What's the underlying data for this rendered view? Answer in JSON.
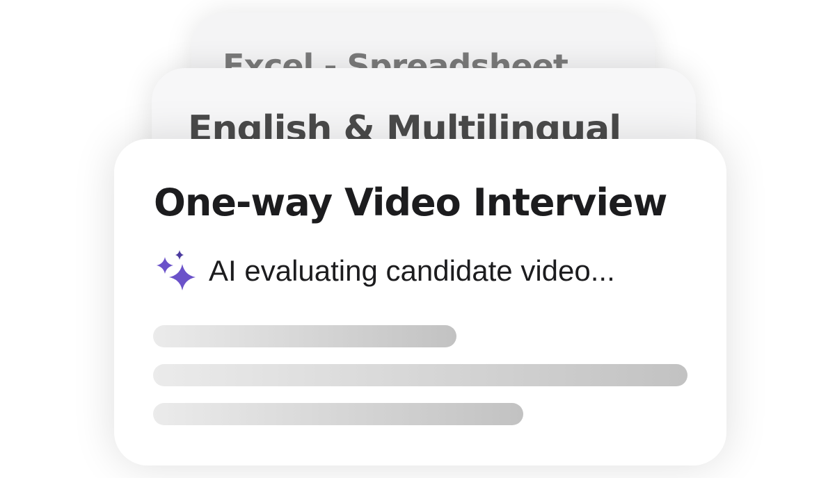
{
  "cards": {
    "back": {
      "title": "Excel - Spreadsheet"
    },
    "middle": {
      "title": "English & Multilingual"
    },
    "front": {
      "title": "One-way Video Interview",
      "status": {
        "icon": "sparkle-icon",
        "text": "AI evaluating candidate video..."
      }
    }
  },
  "colors": {
    "accent": "#6b52c9",
    "accent_dark": "#4b3a9e",
    "title_text": "#1c1c1e"
  }
}
